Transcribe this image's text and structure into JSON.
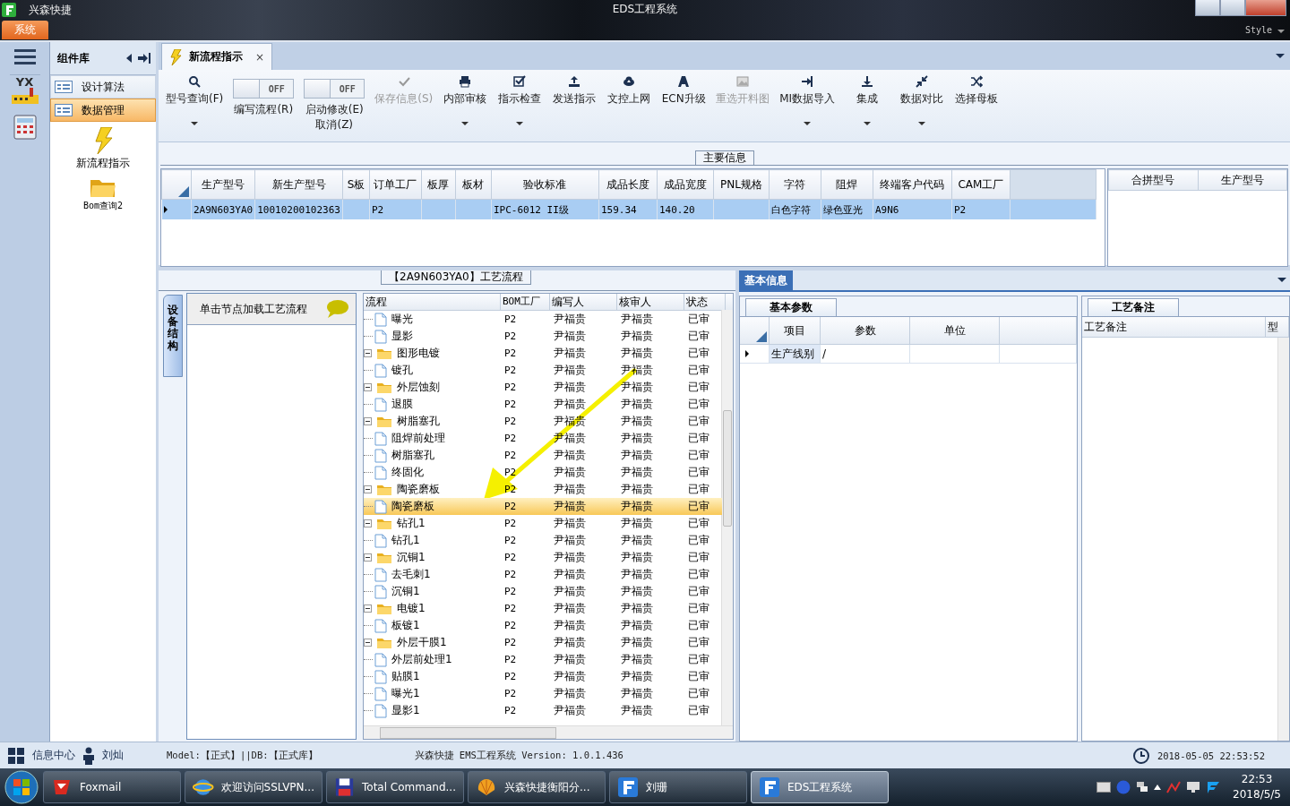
{
  "window": {
    "app_name": "兴森快捷",
    "title": "EDS工程系统",
    "menu_tab": "系统",
    "style_label": "Style"
  },
  "nav_strip": {
    "logo_text": "YX"
  },
  "component_panel": {
    "title": "组件库",
    "groups": [
      {
        "label": "设计算法",
        "selected": false
      },
      {
        "label": "数据管理",
        "selected": true
      }
    ],
    "items": [
      {
        "label": "新流程指示",
        "kind": "lightning"
      },
      {
        "label": "Bom查询2",
        "kind": "folder"
      }
    ]
  },
  "doc_tab": {
    "label": "新流程指示",
    "close": "×"
  },
  "toolbar": [
    {
      "kind": "button",
      "label": "型号查询(F)",
      "dropdown": true,
      "disabled": false
    },
    {
      "kind": "toggle",
      "label": "编写流程(R)",
      "toggle_text": "OFF",
      "on": false
    },
    {
      "kind": "toggle",
      "label": "启动修改(E)\n取消(Z)",
      "toggle_text": "OFF",
      "on": false
    },
    {
      "kind": "button",
      "label": "保存信息(S)",
      "dropdown": false,
      "disabled": true
    },
    {
      "kind": "button",
      "label": "内部审核",
      "dropdown": true,
      "disabled": false
    },
    {
      "kind": "button",
      "label": "指示检查",
      "dropdown": true,
      "disabled": false
    },
    {
      "kind": "button",
      "label": "发送指示",
      "dropdown": false,
      "disabled": false
    },
    {
      "kind": "button",
      "label": "文控上网",
      "dropdown": false,
      "disabled": false
    },
    {
      "kind": "button",
      "label": "ECN升级",
      "dropdown": false,
      "disabled": false
    },
    {
      "kind": "button",
      "label": "重选开料图",
      "dropdown": false,
      "disabled": true
    },
    {
      "kind": "button",
      "label": "MI数据导入",
      "dropdown": true,
      "disabled": false
    },
    {
      "kind": "button",
      "label": "集成",
      "dropdown": true,
      "disabled": false
    },
    {
      "kind": "button",
      "label": "数据对比",
      "dropdown": true,
      "disabled": false
    },
    {
      "kind": "button",
      "label": "选择母板",
      "dropdown": false,
      "disabled": false
    }
  ],
  "main_info": {
    "legend": "主要信息",
    "columns": [
      "生产型号",
      "新生产型号",
      "S板",
      "订单工厂",
      "板厚",
      "板材",
      "验收标准",
      "成品长度",
      "成品宽度",
      "PNL规格",
      "字符",
      "阻焊",
      "终端客户代码",
      "CAM工厂"
    ],
    "rows": [
      {
        "selected": true,
        "cells": [
          "2A9N603YA0",
          "10010200102363",
          null,
          "P2",
          null,
          null,
          "IPC-6012 II级",
          "159.34",
          "140.20",
          null,
          "白色字符",
          "绿色亚光",
          "A9N6",
          "P2"
        ]
      }
    ],
    "side_columns": [
      "合拼型号",
      "生产型号"
    ]
  },
  "flow_panel": {
    "legend": "【2A9N603YA0】工艺流程",
    "side_tab": "设备结构",
    "hint": "单击节点加载工艺流程",
    "columns": [
      "流程",
      "BOM工厂",
      "编写人",
      "核审人",
      "状态"
    ],
    "tree": [
      {
        "children": [
          {
            "label": "曝光",
            "selected": false,
            "cells": [
              "P2",
              "尹福贵",
              "尹福贵",
              "已审"
            ]
          },
          {
            "label": "显影",
            "selected": false,
            "cells": [
              "P2",
              "尹福贵",
              "尹福贵",
              "已审"
            ]
          }
        ]
      },
      {
        "label": "图形电镀",
        "selected": false,
        "expanded": true,
        "cells": [
          "P2",
          "尹福贵",
          "尹福贵",
          "已审"
        ],
        "children": [
          {
            "label": "镀孔",
            "selected": false,
            "cells": [
              "P2",
              "尹福贵",
              "尹福贵",
              "已审"
            ]
          }
        ]
      },
      {
        "label": "外层蚀刻",
        "selected": false,
        "expanded": true,
        "cells": [
          "P2",
          "尹福贵",
          "尹福贵",
          "已审"
        ],
        "children": [
          {
            "label": "退膜",
            "selected": false,
            "cells": [
              "P2",
              "尹福贵",
              "尹福贵",
              "已审"
            ]
          }
        ]
      },
      {
        "label": "树脂塞孔",
        "selected": false,
        "expanded": true,
        "cells": [
          "P2",
          "尹福贵",
          "尹福贵",
          "已审"
        ],
        "children": [
          {
            "label": "阻焊前处理",
            "selected": false,
            "cells": [
              "P2",
              "尹福贵",
              "尹福贵",
              "已审"
            ]
          },
          {
            "label": "树脂塞孔",
            "selected": false,
            "cells": [
              "P2",
              "尹福贵",
              "尹福贵",
              "已审"
            ]
          },
          {
            "label": "终固化",
            "selected": false,
            "cells": [
              "P2",
              "尹福贵",
              "尹福贵",
              "已审"
            ]
          }
        ]
      },
      {
        "label": "陶瓷磨板",
        "selected": false,
        "expanded": true,
        "cells": [
          "P2",
          "尹福贵",
          "尹福贵",
          "已审"
        ],
        "children": [
          {
            "label": "陶瓷磨板",
            "selected": true,
            "cells": [
              "P2",
              "尹福贵",
              "尹福贵",
              "已审"
            ]
          }
        ]
      },
      {
        "label": "钻孔1",
        "selected": false,
        "expanded": true,
        "cells": [
          "P2",
          "尹福贵",
          "尹福贵",
          "已审"
        ],
        "children": [
          {
            "label": "钻孔1",
            "selected": false,
            "cells": [
              "P2",
              "尹福贵",
              "尹福贵",
              "已审"
            ]
          }
        ]
      },
      {
        "label": "沉铜1",
        "selected": false,
        "expanded": true,
        "cells": [
          "P2",
          "尹福贵",
          "尹福贵",
          "已审"
        ],
        "children": [
          {
            "label": "去毛刺1",
            "selected": false,
            "cells": [
              "P2",
              "尹福贵",
              "尹福贵",
              "已审"
            ]
          },
          {
            "label": "沉铜1",
            "selected": false,
            "cells": [
              "P2",
              "尹福贵",
              "尹福贵",
              "已审"
            ]
          }
        ]
      },
      {
        "label": "电镀1",
        "selected": false,
        "expanded": true,
        "cells": [
          "P2",
          "尹福贵",
          "尹福贵",
          "已审"
        ],
        "children": [
          {
            "label": "板镀1",
            "selected": false,
            "cells": [
              "P2",
              "尹福贵",
              "尹福贵",
              "已审"
            ]
          }
        ]
      },
      {
        "label": "外层干膜1",
        "selected": false,
        "expanded": true,
        "cells": [
          "P2",
          "尹福贵",
          "尹福贵",
          "已审"
        ],
        "children": [
          {
            "label": "外层前处理1",
            "selected": false,
            "cells": [
              "P2",
              "尹福贵",
              "尹福贵",
              "已审"
            ]
          },
          {
            "label": "贴膜1",
            "selected": false,
            "cells": [
              "P2",
              "尹福贵",
              "尹福贵",
              "已审"
            ]
          },
          {
            "label": "曝光1",
            "selected": false,
            "cells": [
              "P2",
              "尹福贵",
              "尹福贵",
              "已审"
            ]
          },
          {
            "label": "显影1",
            "selected": false,
            "cells": [
              "P2",
              "尹福贵",
              "尹福贵",
              "已审"
            ]
          }
        ]
      }
    ],
    "annotation": {
      "kind": "arrow"
    }
  },
  "basic_info": {
    "tab": "基本信息",
    "subtab": "基本参数",
    "columns": [
      "项目",
      "参数",
      "单位"
    ],
    "rows": [
      {
        "cells": [
          "生产线别",
          "/",
          null
        ]
      }
    ]
  },
  "process_notes": {
    "tab": "工艺备注",
    "columns": [
      "工艺备注",
      "型"
    ]
  },
  "status_bar": {
    "info_center": "信息中心",
    "user": "刘灿",
    "model_db": "Model:【正式】||DB:【正式库】",
    "version": "兴森快捷 EMS工程系统 Version: 1.0.1.436",
    "datetime": "2018-05-05 22:53:52"
  },
  "taskbar": {
    "items": [
      {
        "label": "Foxmail",
        "kind": "mail",
        "selected": false
      },
      {
        "label": "欢迎访问SSLVPN...",
        "kind": "browser",
        "selected": false
      },
      {
        "label": "Total Command...",
        "kind": "disk",
        "selected": false
      },
      {
        "label": "兴森快捷衡阳分...",
        "kind": "shell",
        "selected": false
      },
      {
        "label": "刘珊",
        "kind": "app",
        "selected": false
      },
      {
        "label": "EDS工程系统",
        "kind": "app",
        "selected": true
      }
    ],
    "time": "22:53",
    "date": "2018/5/5"
  }
}
